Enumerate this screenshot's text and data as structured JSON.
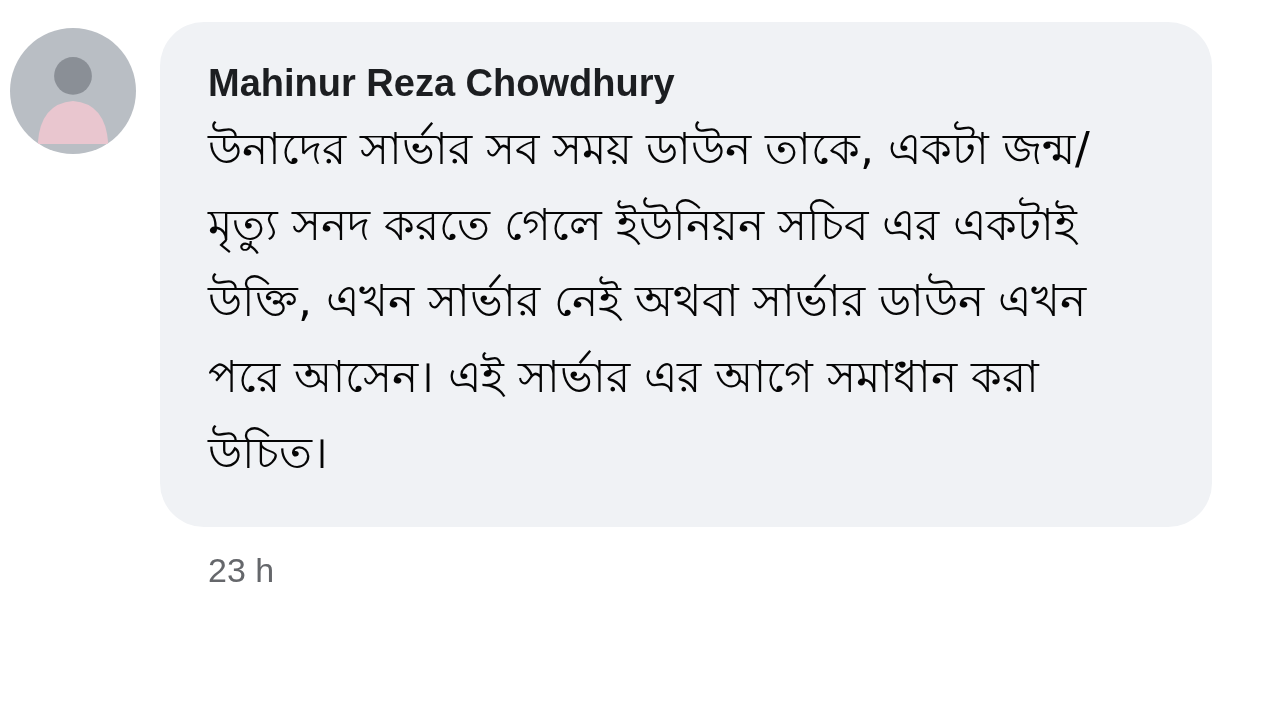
{
  "comment": {
    "author": "Mahinur Reza Chowdhury",
    "text": "উনাদের সার্ভার সব সময় ডাউন তাকে, একটা জন্ম/ মৃত্যু সনদ করতে গেলে ইউনিয়ন সচিব এর একটাই উক্তি, এখন সার্ভার নেই অথবা সার্ভার ডাউন এখন পরে আসেন। এই সার্ভার এর আগে সমাধান করা উচিত।",
    "time": "23 h"
  }
}
